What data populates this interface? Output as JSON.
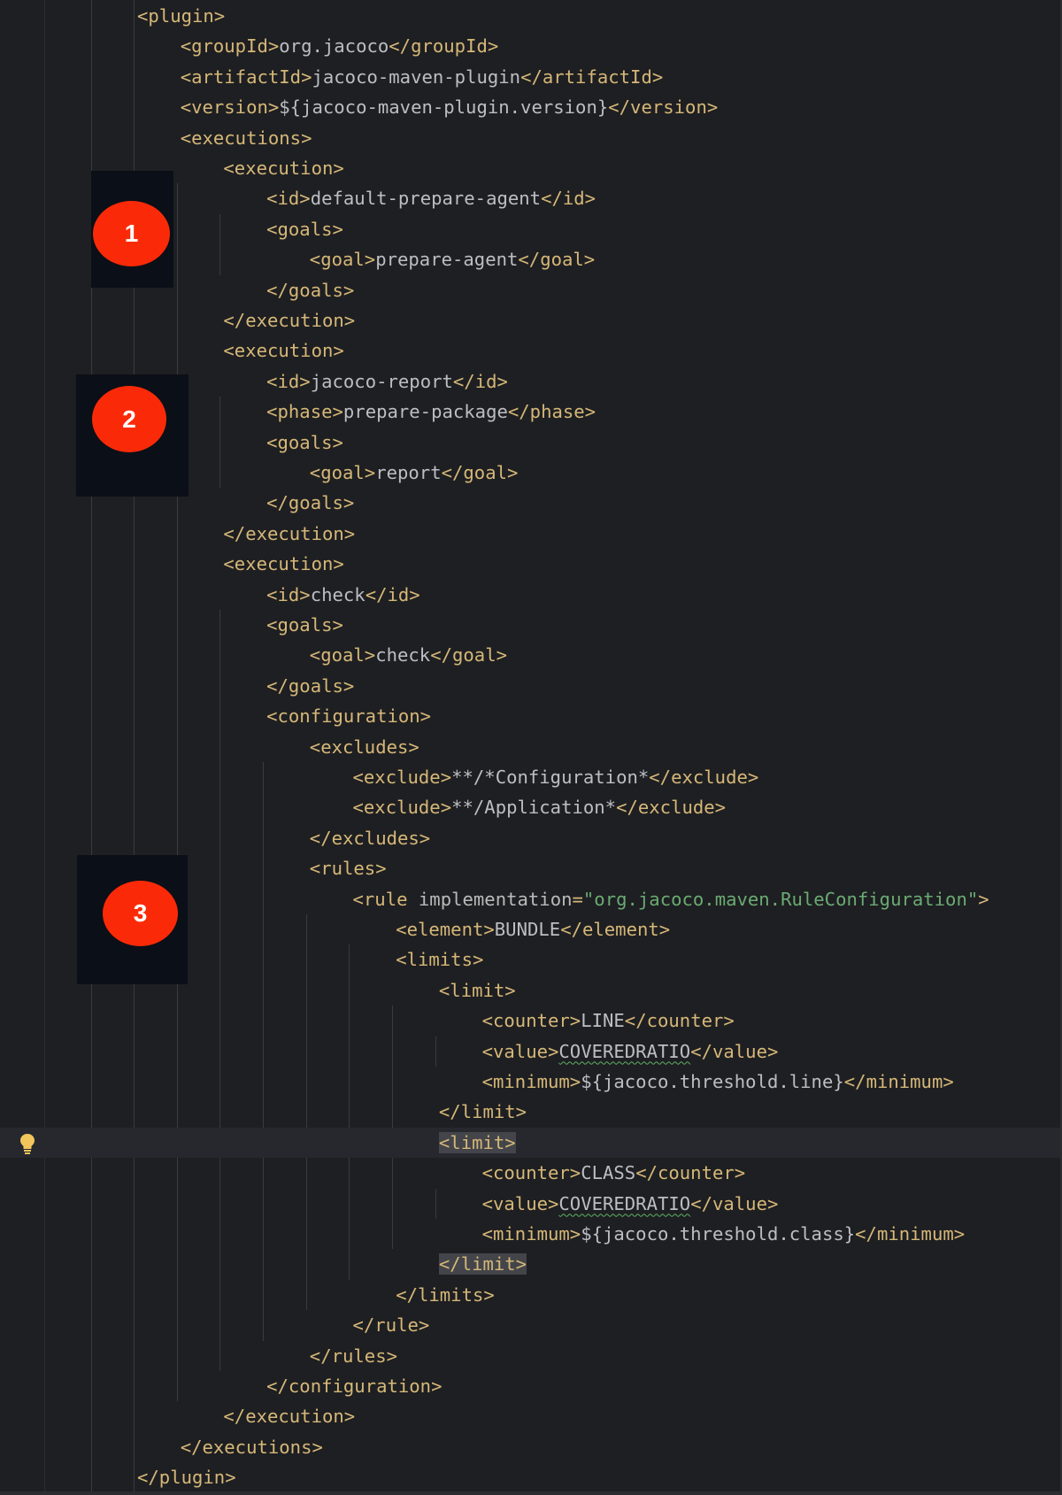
{
  "editor": {
    "lines": [
      {
        "indent": 0,
        "parts": [
          {
            "t": "tag",
            "v": "<plugin>"
          }
        ]
      },
      {
        "indent": 1,
        "parts": [
          {
            "t": "tag",
            "v": "<groupId>"
          },
          {
            "t": "txt",
            "v": "org.jacoco"
          },
          {
            "t": "tag",
            "v": "</groupId>"
          }
        ]
      },
      {
        "indent": 1,
        "parts": [
          {
            "t": "tag",
            "v": "<artifactId>"
          },
          {
            "t": "txt",
            "v": "jacoco-maven-plugin"
          },
          {
            "t": "tag",
            "v": "</artifactId>"
          }
        ]
      },
      {
        "indent": 1,
        "parts": [
          {
            "t": "tag",
            "v": "<version>"
          },
          {
            "t": "txt",
            "v": "${jacoco-maven-plugin.version}"
          },
          {
            "t": "tag",
            "v": "</version>"
          }
        ]
      },
      {
        "indent": 1,
        "parts": [
          {
            "t": "tag",
            "v": "<executions>"
          }
        ]
      },
      {
        "indent": 2,
        "parts": [
          {
            "t": "tag",
            "v": "<execution>"
          }
        ]
      },
      {
        "indent": 3,
        "parts": [
          {
            "t": "tag",
            "v": "<id>"
          },
          {
            "t": "txt",
            "v": "default-prepare-agent"
          },
          {
            "t": "tag",
            "v": "</id>"
          }
        ]
      },
      {
        "indent": 3,
        "parts": [
          {
            "t": "tag",
            "v": "<goals>"
          }
        ]
      },
      {
        "indent": 4,
        "parts": [
          {
            "t": "tag",
            "v": "<goal>"
          },
          {
            "t": "txt",
            "v": "prepare-agent"
          },
          {
            "t": "tag",
            "v": "</goal>"
          }
        ]
      },
      {
        "indent": 3,
        "parts": [
          {
            "t": "tag",
            "v": "</goals>"
          }
        ]
      },
      {
        "indent": 2,
        "parts": [
          {
            "t": "tag",
            "v": "</execution>"
          }
        ]
      },
      {
        "indent": 2,
        "parts": [
          {
            "t": "tag",
            "v": "<execution>"
          }
        ]
      },
      {
        "indent": 3,
        "parts": [
          {
            "t": "tag",
            "v": "<id>"
          },
          {
            "t": "txt",
            "v": "jacoco-report"
          },
          {
            "t": "tag",
            "v": "</id>"
          }
        ]
      },
      {
        "indent": 3,
        "parts": [
          {
            "t": "tag",
            "v": "<phase>"
          },
          {
            "t": "txt",
            "v": "prepare-package"
          },
          {
            "t": "tag",
            "v": "</phase>"
          }
        ]
      },
      {
        "indent": 3,
        "parts": [
          {
            "t": "tag",
            "v": "<goals>"
          }
        ]
      },
      {
        "indent": 4,
        "parts": [
          {
            "t": "tag",
            "v": "<goal>"
          },
          {
            "t": "txt",
            "v": "report"
          },
          {
            "t": "tag",
            "v": "</goal>"
          }
        ]
      },
      {
        "indent": 3,
        "parts": [
          {
            "t": "tag",
            "v": "</goals>"
          }
        ]
      },
      {
        "indent": 2,
        "parts": [
          {
            "t": "tag",
            "v": "</execution>"
          }
        ]
      },
      {
        "indent": 2,
        "parts": [
          {
            "t": "tag",
            "v": "<execution>"
          }
        ]
      },
      {
        "indent": 3,
        "parts": [
          {
            "t": "tag",
            "v": "<id>"
          },
          {
            "t": "txt",
            "v": "check"
          },
          {
            "t": "tag",
            "v": "</id>"
          }
        ]
      },
      {
        "indent": 3,
        "parts": [
          {
            "t": "tag",
            "v": "<goals>"
          }
        ]
      },
      {
        "indent": 4,
        "parts": [
          {
            "t": "tag",
            "v": "<goal>"
          },
          {
            "t": "txt",
            "v": "check"
          },
          {
            "t": "tag",
            "v": "</goal>"
          }
        ]
      },
      {
        "indent": 3,
        "parts": [
          {
            "t": "tag",
            "v": "</goals>"
          }
        ]
      },
      {
        "indent": 3,
        "parts": [
          {
            "t": "tag",
            "v": "<configuration>"
          }
        ]
      },
      {
        "indent": 4,
        "parts": [
          {
            "t": "tag",
            "v": "<excludes>"
          }
        ]
      },
      {
        "indent": 5,
        "parts": [
          {
            "t": "tag",
            "v": "<exclude>"
          },
          {
            "t": "txt",
            "v": "**/*Configuration*"
          },
          {
            "t": "tag",
            "v": "</exclude>"
          }
        ]
      },
      {
        "indent": 5,
        "parts": [
          {
            "t": "tag",
            "v": "<exclude>"
          },
          {
            "t": "txt",
            "v": "**/Application*"
          },
          {
            "t": "tag",
            "v": "</exclude>"
          }
        ]
      },
      {
        "indent": 4,
        "parts": [
          {
            "t": "tag",
            "v": "</excludes>"
          }
        ]
      },
      {
        "indent": 4,
        "parts": [
          {
            "t": "tag",
            "v": "<rules>"
          }
        ]
      },
      {
        "indent": 5,
        "parts": [
          {
            "t": "tag",
            "v": "<rule "
          },
          {
            "t": "attr",
            "v": "implementation"
          },
          {
            "t": "tag",
            "v": "="
          },
          {
            "t": "attrval",
            "v": "\"org.jacoco.maven.RuleConfiguration\""
          },
          {
            "t": "tag",
            "v": ">"
          }
        ]
      },
      {
        "indent": 6,
        "parts": [
          {
            "t": "tag",
            "v": "<element>"
          },
          {
            "t": "txt",
            "v": "BUNDLE"
          },
          {
            "t": "tag",
            "v": "</element>"
          }
        ]
      },
      {
        "indent": 6,
        "parts": [
          {
            "t": "tag",
            "v": "<limits>"
          }
        ]
      },
      {
        "indent": 7,
        "parts": [
          {
            "t": "tag",
            "v": "<limit>"
          }
        ]
      },
      {
        "indent": 8,
        "parts": [
          {
            "t": "tag",
            "v": "<counter>"
          },
          {
            "t": "txt",
            "v": "LINE"
          },
          {
            "t": "tag",
            "v": "</counter>"
          }
        ]
      },
      {
        "indent": 8,
        "parts": [
          {
            "t": "tag",
            "v": "<value>"
          },
          {
            "t": "squig",
            "v": "COVEREDRATIO"
          },
          {
            "t": "tag",
            "v": "</value>"
          }
        ]
      },
      {
        "indent": 8,
        "parts": [
          {
            "t": "tag",
            "v": "<minimum>"
          },
          {
            "t": "txt",
            "v": "${jacoco.threshold.line}"
          },
          {
            "t": "tag",
            "v": "</minimum>"
          }
        ]
      },
      {
        "indent": 7,
        "parts": [
          {
            "t": "tag",
            "v": "</limit>"
          }
        ]
      },
      {
        "indent": 7,
        "current": true,
        "parts": [
          {
            "t": "taghl",
            "v": "<limit>"
          }
        ]
      },
      {
        "indent": 8,
        "parts": [
          {
            "t": "tag",
            "v": "<counter>"
          },
          {
            "t": "txt",
            "v": "CLASS"
          },
          {
            "t": "tag",
            "v": "</counter>"
          }
        ]
      },
      {
        "indent": 8,
        "parts": [
          {
            "t": "tag",
            "v": "<value>"
          },
          {
            "t": "squig",
            "v": "COVEREDRATIO"
          },
          {
            "t": "tag",
            "v": "</value>"
          }
        ]
      },
      {
        "indent": 8,
        "parts": [
          {
            "t": "tag",
            "v": "<minimum>"
          },
          {
            "t": "txt",
            "v": "${jacoco.threshold.class}"
          },
          {
            "t": "tag",
            "v": "</minimum>"
          }
        ]
      },
      {
        "indent": 7,
        "parts": [
          {
            "t": "taghl",
            "v": "</limit>"
          }
        ]
      },
      {
        "indent": 6,
        "parts": [
          {
            "t": "tag",
            "v": "</limits>"
          }
        ]
      },
      {
        "indent": 5,
        "parts": [
          {
            "t": "tag",
            "v": "</rule>"
          }
        ]
      },
      {
        "indent": 4,
        "parts": [
          {
            "t": "tag",
            "v": "</rules>"
          }
        ]
      },
      {
        "indent": 3,
        "parts": [
          {
            "t": "tag",
            "v": "</configuration>"
          }
        ]
      },
      {
        "indent": 2,
        "parts": [
          {
            "t": "tag",
            "v": "</execution>"
          }
        ]
      },
      {
        "indent": 1,
        "parts": [
          {
            "t": "tag",
            "v": "</executions>"
          }
        ]
      },
      {
        "indent": 0,
        "parts": [
          {
            "t": "tag",
            "v": "</plugin>"
          }
        ]
      }
    ]
  },
  "gutter": {
    "bulb_icon": "lightbulb-icon",
    "bulb_color": "#f2c55c"
  },
  "markers": [
    {
      "label": "1"
    },
    {
      "label": "2"
    },
    {
      "label": "3"
    }
  ],
  "colors": {
    "background": "#1e1f22",
    "tag": "#d5b778",
    "text": "#bcbec4",
    "attribute_value": "#6aab73",
    "marker": "#fa2a08",
    "marker_box": "#0b0f17"
  }
}
